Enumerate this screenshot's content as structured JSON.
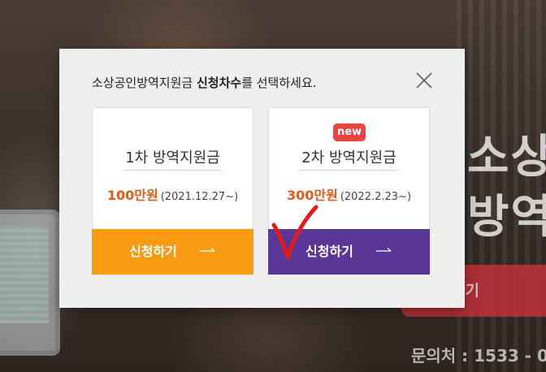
{
  "background": {
    "heading_line1": "소상",
    "heading_line2": "방역",
    "apply_button": "신청하기",
    "contact": "문의처 : 1533 - 0"
  },
  "modal": {
    "title_prefix": "소상공인방역지원금 ",
    "title_bold": "신청차수",
    "title_suffix": "를 선택하세요.",
    "close_icon": "close-icon",
    "cards": [
      {
        "title": "1차 방역지원금",
        "amount": "100만원",
        "date": "(2021.12.27~)",
        "button_label": "신청하기",
        "button_color": "#f89a12"
      },
      {
        "badge": "new",
        "title": "2차 방역지원금",
        "amount": "300만원",
        "date": "(2022.2.23~)",
        "button_label": "신청하기",
        "button_color": "#5a3797"
      }
    ]
  },
  "colors": {
    "accent_orange": "#f89a12",
    "accent_purple": "#5a3797",
    "amount_red": "#e25b1a",
    "badge_red": "#e84545",
    "checkmark_red": "#e01b1b"
  }
}
